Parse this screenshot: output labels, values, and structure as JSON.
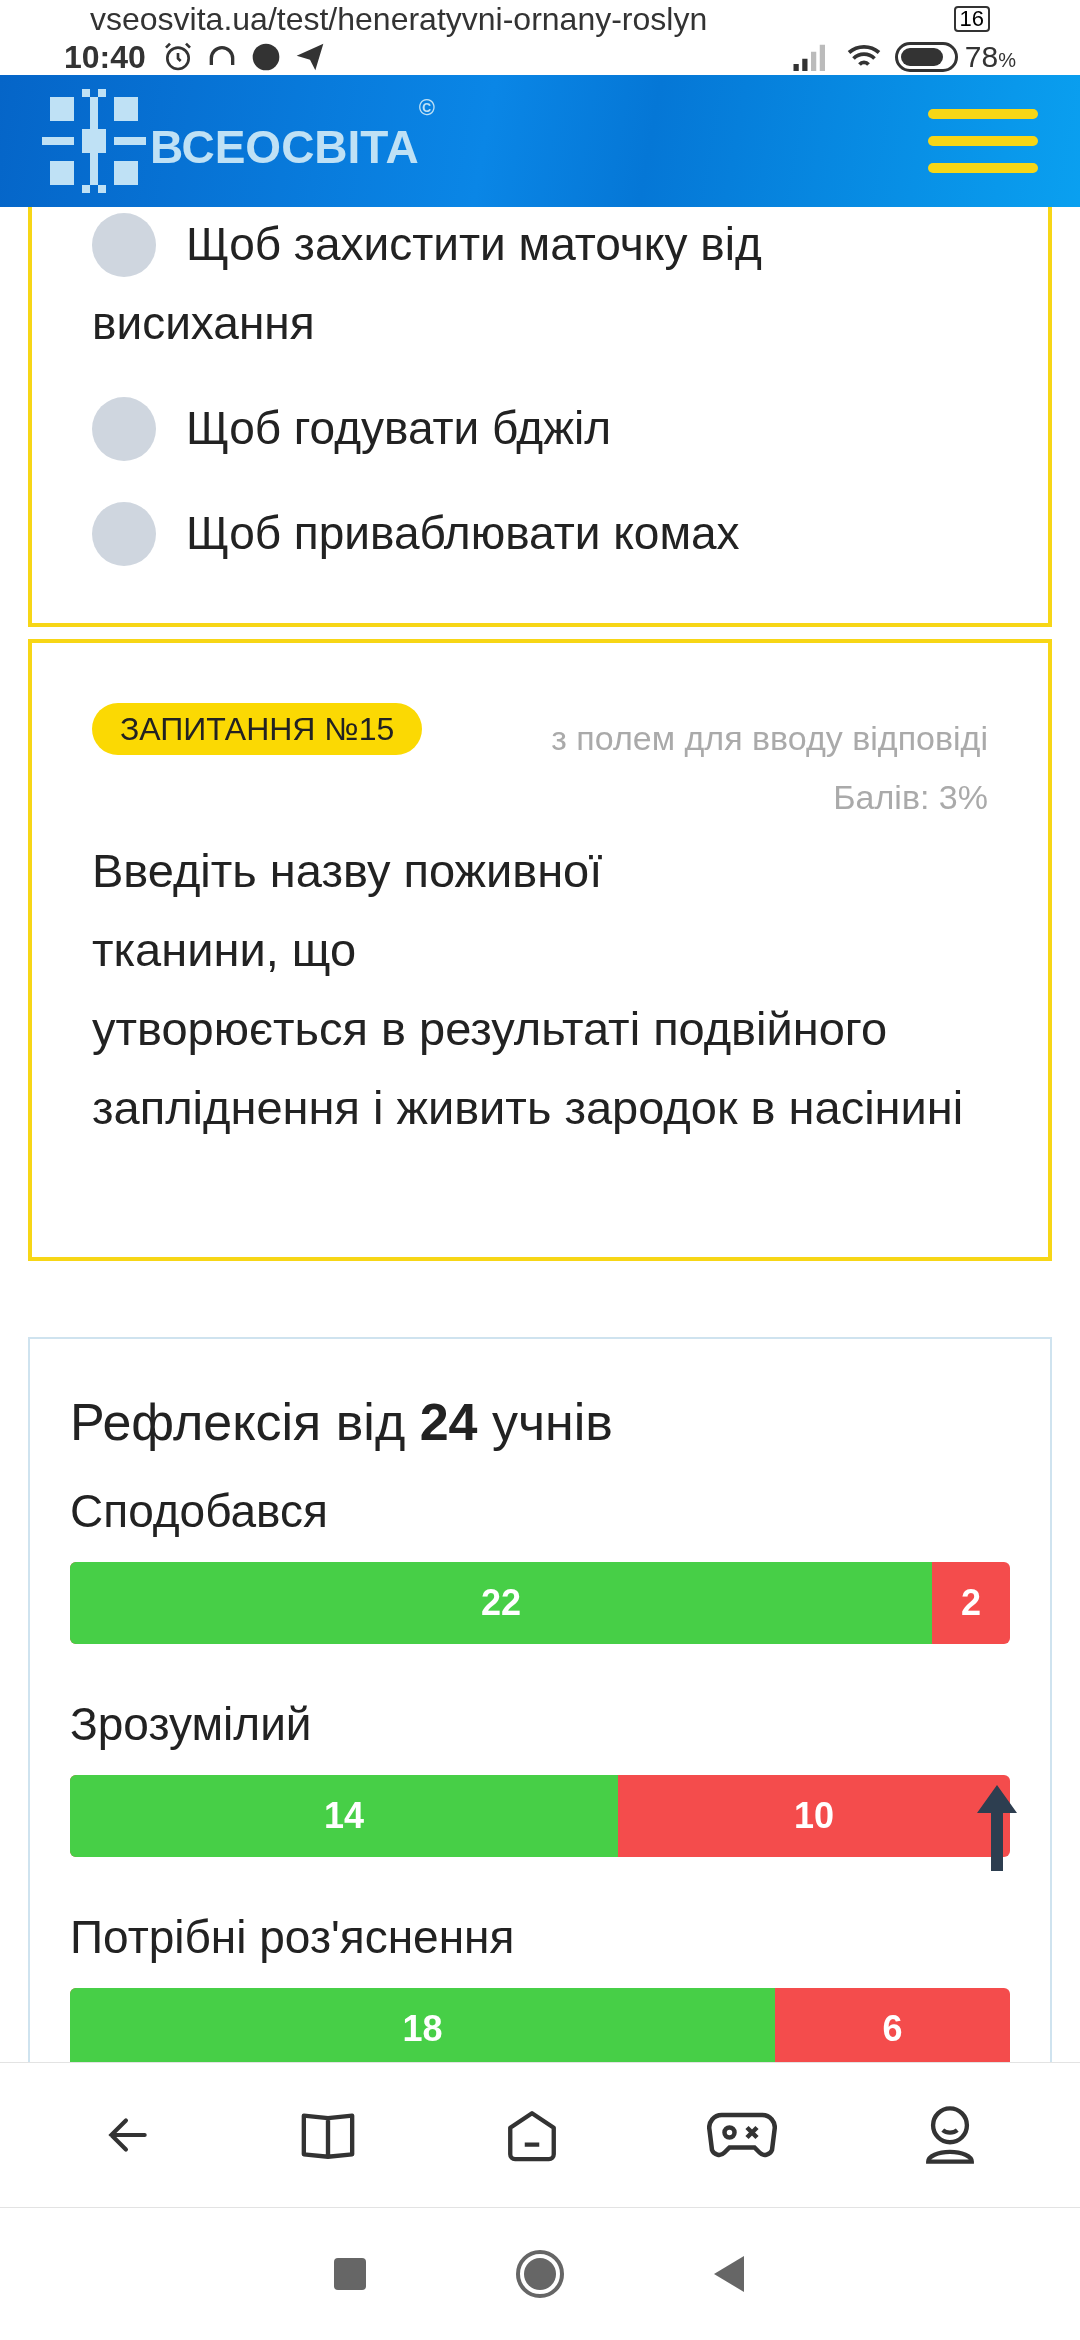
{
  "browser": {
    "url": "vseosvita.ua/test/heneratyvni-ornany-roslyn",
    "tab_count": "16"
  },
  "status_bar": {
    "time": "10:40",
    "battery": "78",
    "battery_unit": "%"
  },
  "header": {
    "logo_text": "ВСЕОСВІТА",
    "logo_mark": "©"
  },
  "previous_question": {
    "options": [
      {
        "text": "Щоб захистити маточку від висихання",
        "selected": false
      },
      {
        "text": "Щоб годувати бджіл",
        "selected": false
      },
      {
        "text": "Щоб приваблювати комах",
        "selected": false
      }
    ]
  },
  "question": {
    "badge": "ЗАПИТАННЯ №15",
    "type": "з полем для вводу відповіді",
    "points": "Балів: 3%",
    "text": "Введіть назву поживної тканини, що утворюється в результаті подвійного запліднення і живить зародок в насінині"
  },
  "reflection": {
    "title": "Рефлексія від **24** учнів",
    "rows": [
      {
        "label": "Сподобався",
        "yes": "22",
        "no": "2",
        "level": 0.917
      },
      {
        "label": "Зрозумілий",
        "yes": "14",
        "no": "10",
        "level": 0.583
      },
      {
        "label": "Потрібні роз'яснення",
        "yes": "18",
        "no": "6",
        "level": 0.75
      }
    ]
  }
}
